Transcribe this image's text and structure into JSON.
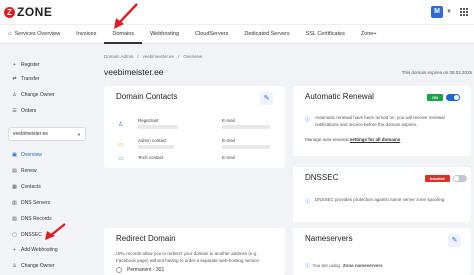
{
  "header": {
    "logo_mark": "Z",
    "logo_text": "ZONE",
    "avatar_letter": "M"
  },
  "nav": {
    "items": [
      {
        "label": "Services Overview"
      },
      {
        "label": "Invoices"
      },
      {
        "label": "Domains"
      },
      {
        "label": "Webhosting"
      },
      {
        "label": "CloudServers"
      },
      {
        "label": "Dedicated Servers"
      },
      {
        "label": "SSL Certificates"
      },
      {
        "label": "Zone+"
      }
    ]
  },
  "sidebar": {
    "items": [
      {
        "label": "Register"
      },
      {
        "label": "Transfer"
      },
      {
        "label": "Change Owner"
      },
      {
        "label": "Orders"
      }
    ],
    "selected_domain": "veebimeister.ee",
    "domain_items": [
      {
        "label": "Overview"
      },
      {
        "label": "Renew"
      },
      {
        "label": "Contacts"
      },
      {
        "label": "DNS Servers"
      },
      {
        "label": "DNS Records"
      },
      {
        "label": "DNSSEC"
      },
      {
        "label": "Add Webhosting"
      },
      {
        "label": "Change Owner"
      }
    ]
  },
  "breadcrumb": [
    "Domain Admin",
    "/",
    "veebimeister.ee",
    "/",
    "Overview"
  ],
  "page_title": "veebimeister.ee",
  "expiry_text": "This domain expires on 08.02.2025",
  "contacts_card": {
    "title": "Domain Contacts",
    "rows": [
      {
        "label": "Registrant",
        "email_label": "E-mail"
      },
      {
        "label": "Admin contact",
        "email_label": "E-mail"
      },
      {
        "label": "Tech contact",
        "email_label": "E-mail"
      }
    ]
  },
  "renewal_card": {
    "title": "Automatic Renewal",
    "badge": "ON",
    "info": "Automatic renewal have been turned on, you will receive renewal notifications and invoice before the domain expires.",
    "manage_prefix": "Manage auto-renewal",
    "manage_link": "settings for all domains"
  },
  "redirect_card": {
    "title": "Redirect Domain",
    "text": "URL records allow you to redirect your domain to another address (e.g. Facebook page) without having to order a separate web-hosting service.",
    "option": "Permanent - 301"
  },
  "dnssec_card": {
    "title": "DNSSEC",
    "badge": "Inactive",
    "info": "DNSSEC provides protection against name server zone spoofing"
  },
  "nameservers_card": {
    "title": "Nameservers",
    "text_prefix": "You are using",
    "text_bold": "Zone nameservers"
  },
  "colors": {
    "brand_red": "#e21b23",
    "accent_blue": "#1f66d1",
    "on_green": "#1aa34a",
    "inactive_red": "#d9342b",
    "background": "#f1f3f6"
  }
}
